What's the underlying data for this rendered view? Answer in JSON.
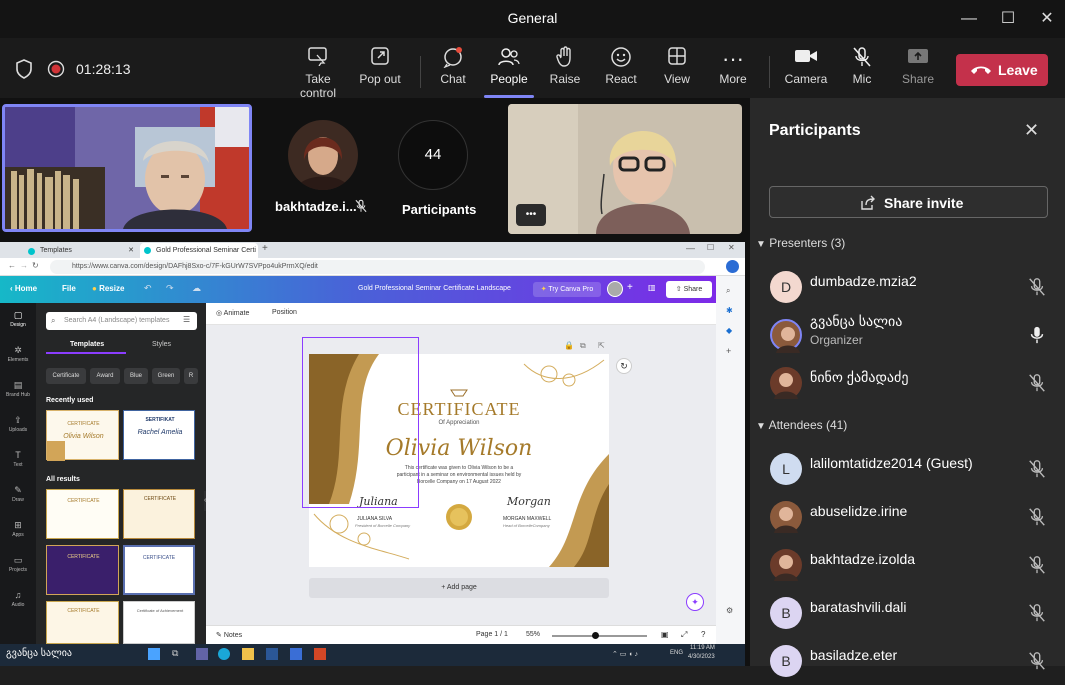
{
  "window": {
    "title": "General"
  },
  "window_controls": {
    "minimize": "—",
    "maximize": "☐",
    "close": "✕"
  },
  "meeting": {
    "timer": "01:28:13"
  },
  "toolbar": {
    "take_control": "Take control",
    "pop_out": "Pop out",
    "chat": "Chat",
    "people": "People",
    "raise": "Raise",
    "react": "React",
    "view": "View",
    "more": "More",
    "camera": "Camera",
    "mic": "Mic",
    "share": "Share",
    "leave": "Leave"
  },
  "stage": {
    "tile2_name": "bakhtadze.i...",
    "participants_count": "44",
    "participants_label": "Participants",
    "more_dots": "•••"
  },
  "panel": {
    "title": "Participants",
    "share_invite": "Share invite",
    "presenters_header": "Presenters (3)",
    "attendees_header": "Attendees (41)",
    "presenters": [
      {
        "name": "dumbadze.mzia2",
        "initial": "D",
        "sub": ""
      },
      {
        "name": "გვანცა სალია",
        "initial": "",
        "sub": "Organizer"
      },
      {
        "name": "ნინო ქამადაძე",
        "initial": "",
        "sub": ""
      }
    ],
    "attendees": [
      {
        "name": "lalilomtatidze2014 (Guest)",
        "initial": "L"
      },
      {
        "name": "abuselidze.irine",
        "initial": ""
      },
      {
        "name": "bakhtadze.izolda",
        "initial": ""
      },
      {
        "name": "baratashvili.dali",
        "initial": "B"
      },
      {
        "name": "basiladze.eter",
        "initial": "B"
      }
    ]
  },
  "browser": {
    "tab1": "Templates",
    "tab2": "Gold Professional Seminar Certi",
    "url": "https://www.canva.com/design/DAFhj8Sxo-c/7F-kGUrW7SVPpo4ukPrmXQ/edit",
    "canva_home": "Home",
    "canva_file": "File",
    "canva_resize": "Resize",
    "doc_title": "Gold Professional Seminar Certificate Landscape",
    "try_pro": "Try Canva Pro",
    "share": "Share",
    "animate": "Animate",
    "position": "Position",
    "search_placeholder": "Search A4 (Landscape) templates",
    "tab_templates": "Templates",
    "tab_styles": "Styles",
    "chips": [
      "Certificate",
      "Award",
      "Blue",
      "Green",
      "R"
    ],
    "recently_used": "Recently used",
    "all_results": "All results",
    "sidebar": [
      "Design",
      "Elements",
      "Brand Hub",
      "Uploads",
      "Text",
      "Draw",
      "Apps",
      "Projects",
      "Audio"
    ],
    "add_page": "+ Add page",
    "notes": "Notes",
    "page_indicator": "Page 1 / 1",
    "zoom": "55%",
    "taskbar_user": "გვანცა სალია",
    "time": "11:19 AM",
    "date": "4/30/2023",
    "lang": "ENG"
  },
  "certificate": {
    "heading": "CERTIFICATE",
    "sub": "Of Appreciation",
    "name": "Olivia Wilson",
    "body": "This certificate was given to Olivia Wilson to be a participant in a seminar on environmental issues held by Borcelle Company on 17 August 2022",
    "sig1_script": "Juliana",
    "sig1_name": "JULIANA SILVA",
    "sig1_role": "President of Borcelle Company",
    "sig2_script": "Morgan",
    "sig2_name": "MORGAN MAXWELL",
    "sig2_role": "Head of BorcelleCompany"
  },
  "thumbs": {
    "t1": "CERTIFICATE",
    "t2_title": "SERTIFIKAT",
    "t2_name": "Rachel Amelia",
    "t3": "CERTIFICATE",
    "t4": "CERTIFICATE",
    "t5": "CERTIFICATE",
    "t6": "CERTIFICATE",
    "t7": "CERTIFICATE",
    "t8": "Certificate of Achievement"
  },
  "colors": {
    "accent": "#7f85f5",
    "leave": "#c4314b",
    "canva_bar": "#7d2ae8",
    "gold": "#b8862b"
  }
}
